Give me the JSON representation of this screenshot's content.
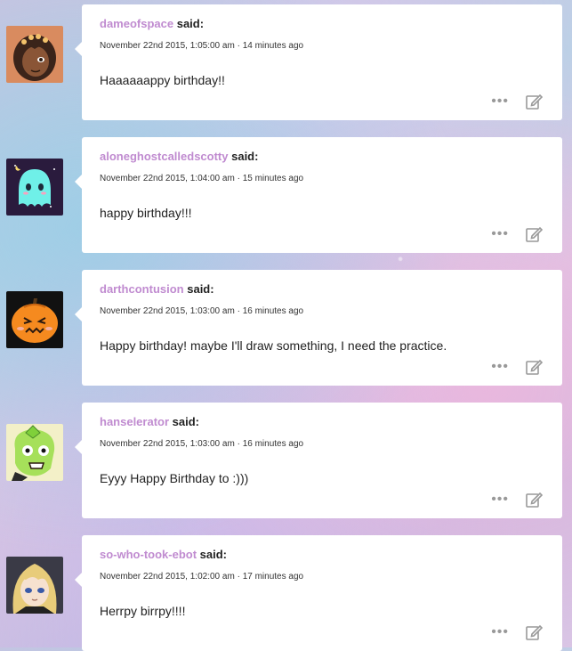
{
  "said_label": "said:",
  "meta_separator": "·",
  "icons": {
    "more": "more-options-icon",
    "edit": "edit-icon"
  },
  "colors": {
    "username": "#c08bd0",
    "card": "#ffffff"
  },
  "comments": [
    {
      "username": "dameofspace",
      "date": "November 22nd 2015, 1:05:00 am",
      "ago": "14 minutes ago",
      "text": "Haaaaaappy birthday!!",
      "avatar": "dark-haired-character-avatar"
    },
    {
      "username": "aloneghostcalledscotty",
      "date": "November 22nd 2015, 1:04:00 am",
      "ago": "15 minutes ago",
      "text": "happy birthday!!!",
      "avatar": "cyan-ghost-avatar"
    },
    {
      "username": "darthcontusion",
      "date": "November 22nd 2015, 1:03:00 am",
      "ago": "16 minutes ago",
      "text": "Happy birthday! maybe I'll draw something, I need the practice.",
      "avatar": "orange-pumpkin-avatar"
    },
    {
      "username": "hanselerator",
      "date": "November 22nd 2015, 1:03:00 am",
      "ago": "16 minutes ago",
      "text": "Eyyy Happy Birthday to :)))",
      "avatar": "green-character-avatar"
    },
    {
      "username": "so-who-took-ebot",
      "date": "November 22nd 2015, 1:02:00 am",
      "ago": "17 minutes ago",
      "text": "Herrpy birrpy!!!!",
      "avatar": "blonde-character-avatar"
    }
  ]
}
